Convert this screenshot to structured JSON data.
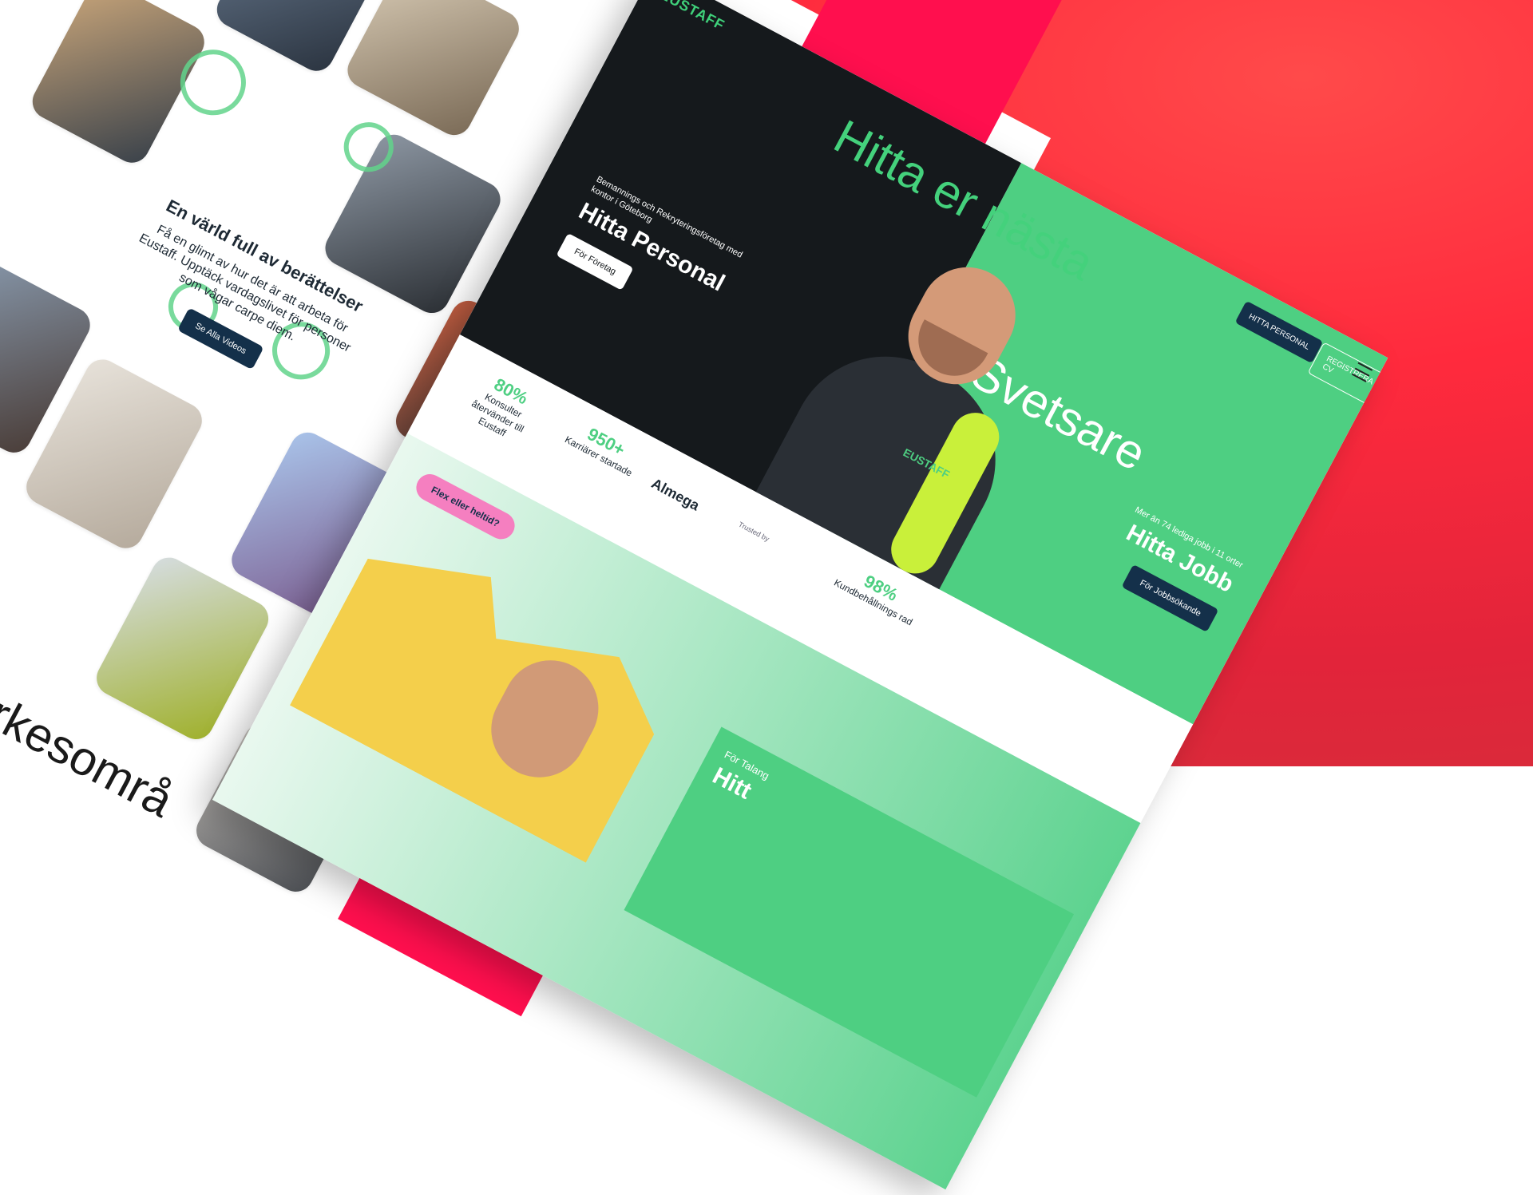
{
  "left_page": {
    "story_heading": "En värld full av berättelser",
    "story_text": "Få en glimt av hur det är att arbeta för Eustaff. Upptäck vardagslivet för personer som vågar carpe diem.",
    "story_button": "Se Alla Videos",
    "bottom_text": "or efter yrkesområ"
  },
  "site": {
    "logo": "EUSTAFF",
    "hero_title_left": "Hitta er nästa",
    "hero_title_right": "Svetsare",
    "nav": {
      "personal": "HITTA PERSONAL",
      "cv": "REGISTRERA CV"
    },
    "left_sub": "Bemannings och Rekryteringsföretag med kontor i Göteborg",
    "left_big": "Hitta Personal",
    "left_button": "För Företag",
    "right_sub": "Mer än 74 lediga jobb i 11 orter",
    "right_big": "Hitta Jobb",
    "right_button": "För Jobbsökande",
    "chest_logo": "EUSTAFF",
    "stats": [
      {
        "num": "80%",
        "label": "Konsulter återvänder till Eustaff"
      },
      {
        "num": "950+",
        "label": "Karriärer startade"
      }
    ],
    "partner": "Almega",
    "trusted": "Trusted by",
    "kund": {
      "num": "98%",
      "label": "Kundbehållnings rad"
    },
    "pill": "Flex eller heltid?",
    "talang_label": "För Talang",
    "talang_big": "Hitt"
  },
  "colors": {
    "brand_green": "#4ecf82",
    "navy": "#14304a",
    "dark": "#15191c",
    "pink": "#ff0f4e"
  }
}
